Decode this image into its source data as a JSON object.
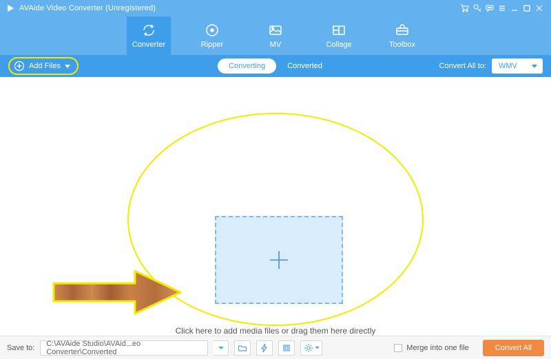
{
  "titlebar": {
    "title": "AVAide Video Converter (Unregistered)"
  },
  "tabs": {
    "converter": "Converter",
    "ripper": "Ripper",
    "mv": "MV",
    "collage": "Collage",
    "toolbox": "Toolbox"
  },
  "subbar": {
    "add_files": "Add Files",
    "converting": "Converting",
    "converted": "Converted",
    "convert_all_to": "Convert All to:",
    "format": "WMV"
  },
  "main": {
    "hint": "Click here to add media files or drag them here directly"
  },
  "bottom": {
    "save_to_label": "Save to:",
    "save_path": "C:\\AVAide Studio\\AVAid...eo Converter\\Converted",
    "merge_label": "Merge into one file",
    "convert_all": "Convert All"
  }
}
